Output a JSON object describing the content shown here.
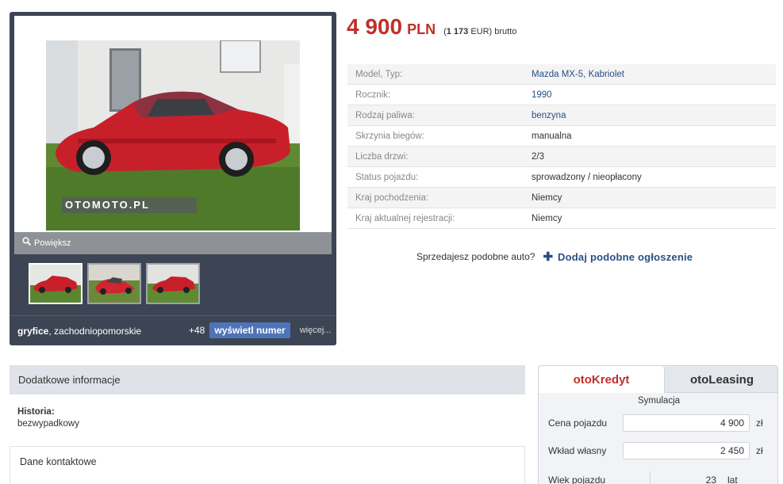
{
  "gallery": {
    "zoom_label": "Powiększ",
    "watermark": "OTOMOTO.PL",
    "location_city": "gryfice",
    "location_region": ", zachodniopomorskie",
    "phone_prefix": "+48",
    "phone_button": "wyświetl numer",
    "more_link": "więcej..."
  },
  "price": {
    "amount": "4 900",
    "currency": "PLN",
    "eur_open": "(",
    "eur_amount": "1 173",
    "eur_rest": " EUR) brutto"
  },
  "params": [
    {
      "key": "Model, Typ:",
      "value": "Mazda MX-5, Kabriolet",
      "link": true
    },
    {
      "key": "Rocznik:",
      "value": "1990",
      "link": true
    },
    {
      "key": "Rodzaj paliwa:",
      "value": "benzyna",
      "link": true
    },
    {
      "key": "Skrzynia biegów:",
      "value": "manualna",
      "link": false
    },
    {
      "key": "Liczba drzwi:",
      "value": "2/3",
      "link": false
    },
    {
      "key": "Status pojazdu:",
      "value": "sprowadzony / nieopłacony",
      "link": false
    },
    {
      "key": "Kraj pochodzenia:",
      "value": "Niemcy",
      "link": false
    },
    {
      "key": "Kraj aktualnej rejestracji:",
      "value": "Niemcy",
      "link": false
    }
  ],
  "similar": {
    "question": "Sprzedajesz podobne auto?",
    "add_label": "Dodaj podobne ogłoszenie"
  },
  "additional": {
    "header": "Dodatkowe informacje",
    "history_label": "Historia:",
    "history_value": "bezwypadkowy"
  },
  "contact": {
    "title": "Dane kontaktowe"
  },
  "credit": {
    "tab_credit": "otoKredyt",
    "tab_leasing": "otoLeasing",
    "simulation": "Symulacja",
    "rows": [
      {
        "label": "Cena pojazdu",
        "value": "4 900",
        "unit": "zł"
      },
      {
        "label": "Wkład własny",
        "value": "2 450",
        "unit": "zł"
      },
      {
        "label": "Wiek pojazdu",
        "value": "23",
        "unit": "lat"
      }
    ]
  },
  "colors": {
    "accent_red": "#c0302a",
    "link_blue": "#2a4f82",
    "gallery_bg": "#3d4454",
    "phone_button": "#4e74b8"
  }
}
